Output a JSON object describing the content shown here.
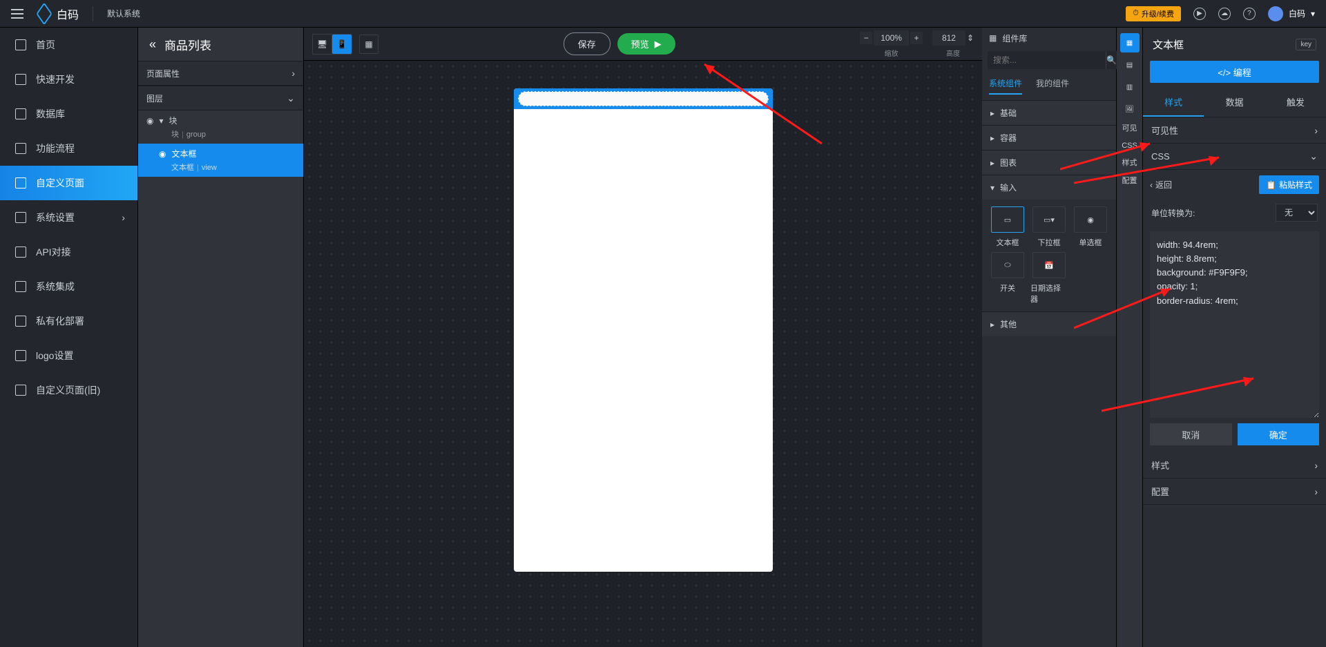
{
  "brand": "白码",
  "system_label": "默认系统",
  "top": {
    "upgrade": "升级/续费",
    "user": "白码"
  },
  "leftnav": [
    {
      "label": "首页"
    },
    {
      "label": "快速开发"
    },
    {
      "label": "数据库"
    },
    {
      "label": "功能流程"
    },
    {
      "label": "自定义页面",
      "active": true
    },
    {
      "label": "系统设置",
      "has_sub": true
    },
    {
      "label": "API对接"
    },
    {
      "label": "系统集成"
    },
    {
      "label": "私有化部署"
    },
    {
      "label": "logo设置"
    },
    {
      "label": "自定义页面(旧)"
    }
  ],
  "layers": {
    "crumb": "商品列表",
    "panel_props": "页面属性",
    "panel_layers": "图层",
    "tree": [
      {
        "name": "块",
        "type": "块",
        "sub": "group",
        "indent": 0
      },
      {
        "name": "文本框",
        "type": "文本框",
        "sub": "view",
        "indent": 1,
        "selected": true
      }
    ]
  },
  "center": {
    "save": "保存",
    "preview": "预览",
    "zoom_value": "100%",
    "zoom_label": "缩放",
    "height_value": "812",
    "height_label": "高度"
  },
  "complib": {
    "title": "组件库",
    "search_placeholder": "搜索...",
    "tabs": {
      "system": "系统组件",
      "mine": "我的组件"
    },
    "sections": {
      "basic": "基础",
      "container": "容器",
      "chart": "图表",
      "input": "输入",
      "other": "其他"
    },
    "input_items": [
      {
        "label": "文本框"
      },
      {
        "label": "下拉框"
      },
      {
        "label": "单选框"
      },
      {
        "label": "开关"
      },
      {
        "label": "日期选择器"
      }
    ]
  },
  "rail": {
    "visible": "可见",
    "css": "CSS",
    "style": "样式",
    "config": "配置"
  },
  "inspector": {
    "title": "文本框",
    "key": "key",
    "code_btn": "</>  编程",
    "tabs": {
      "style": "样式",
      "data": "数据",
      "trigger": "触发"
    },
    "acc_visibility": "可见性",
    "acc_css": "CSS",
    "back": "返回",
    "paste": "粘贴样式",
    "unit_label": "单位转换为:",
    "unit_value": "无",
    "css_text": "width: 94.4rem;\nheight: 8.8rem;\nbackground: #F9F9F9;\nopacity: 1;\nborder-radius: 4rem;",
    "cancel": "取消",
    "ok": "确定",
    "acc_style": "样式",
    "acc_config": "配置"
  }
}
